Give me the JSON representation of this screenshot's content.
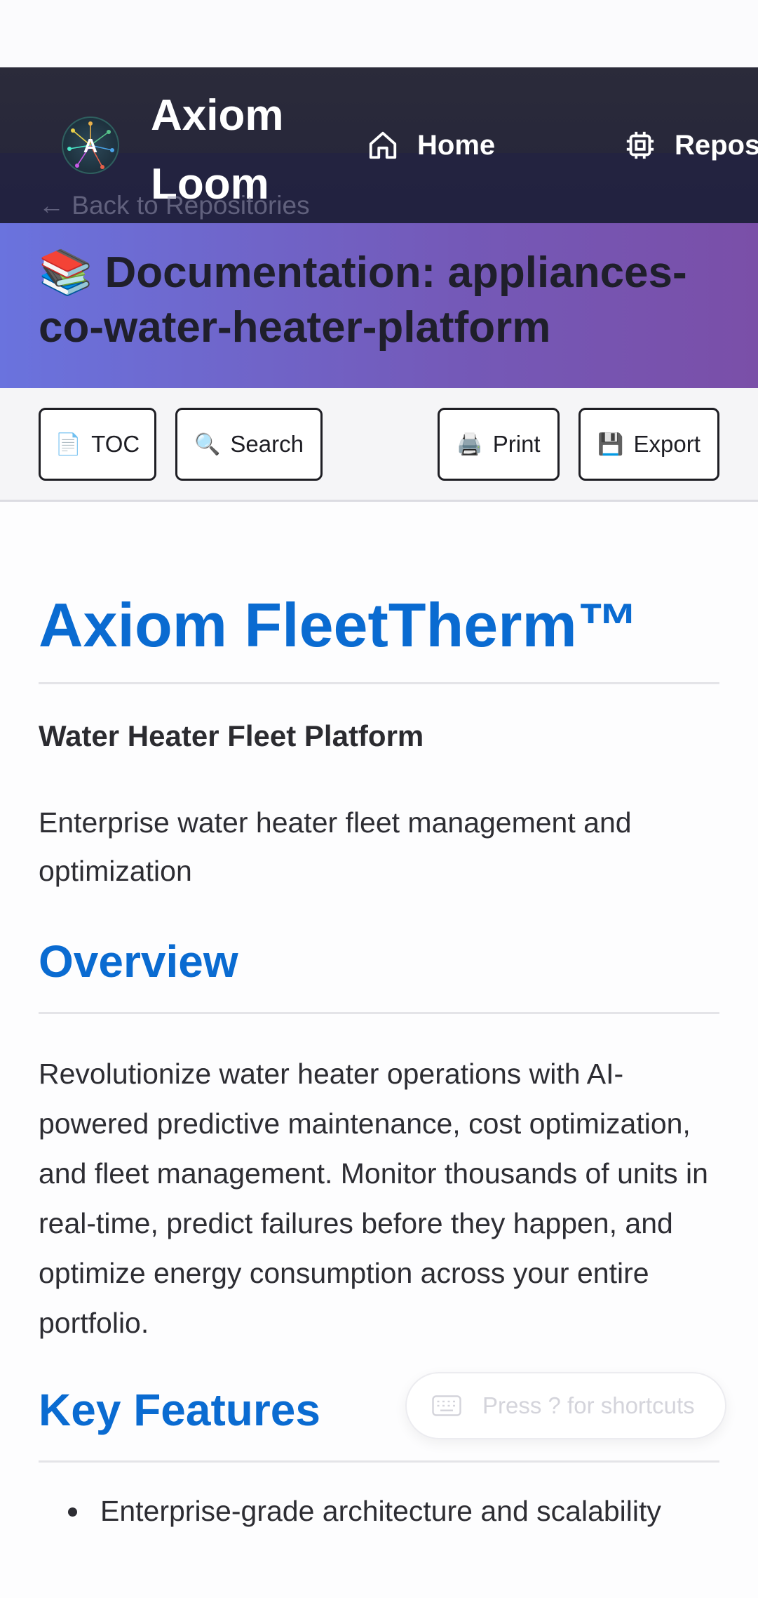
{
  "nav": {
    "brand": "Axiom Loom",
    "logo_letter": "A",
    "links": [
      {
        "label": "Home",
        "icon": "home-icon"
      },
      {
        "label": "Repos",
        "icon": "chip-icon"
      }
    ]
  },
  "back_link": "← Back to Repositories",
  "doc_header": {
    "icon": "📚",
    "title": "Documentation: appliances-co-water-heater-platform"
  },
  "toolbar": {
    "toc": {
      "icon": "📄",
      "label": "TOC"
    },
    "search": {
      "icon": "🔍",
      "label": "Search"
    },
    "print": {
      "icon": "🖨️",
      "label": "Print"
    },
    "export": {
      "icon": "💾",
      "label": "Export"
    }
  },
  "content": {
    "title": "Axiom FleetTherm™",
    "subtitle": "Water Heater Fleet Platform",
    "tagline": "Enterprise water heater fleet management and optimization",
    "overview_heading": "Overview",
    "overview_text": "Revolutionize water heater operations with AI-powered predictive maintenance, cost optimization, and fleet management. Monitor thousands of units in real-time, predict failures before they happen, and optimize energy consumption across your entire portfolio.",
    "features_heading": "Key Features",
    "features": [
      "Enterprise-grade architecture and scalability"
    ]
  },
  "shortcuts_hint": "Press ? for shortcuts",
  "colors": {
    "accent": "#0a6bd1",
    "navbar": "#2b2b3a",
    "header_gradient_start": "#6a73de",
    "header_gradient_end": "#7a4fa8"
  }
}
